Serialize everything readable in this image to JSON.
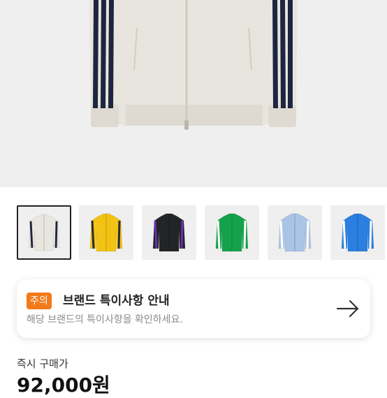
{
  "product": {
    "thumbnails": [
      {
        "name": "cream",
        "body": "#e9e6df",
        "stripe": "#1e2540",
        "selected": true
      },
      {
        "name": "yellow",
        "body": "#f2c315",
        "stripe": "#2d2d2d",
        "selected": false
      },
      {
        "name": "black",
        "body": "#222426",
        "stripe": "#6a2fb0",
        "selected": false
      },
      {
        "name": "green",
        "body": "#13a24b",
        "stripe": "#ffffff",
        "selected": false
      },
      {
        "name": "light-blue",
        "body": "#a9c4e6",
        "stripe": "#ffffff",
        "selected": false
      },
      {
        "name": "blue",
        "body": "#2a7fe0",
        "stripe": "#ffffff",
        "selected": false
      }
    ]
  },
  "notice": {
    "badge": "주의",
    "title": "브랜드 특이사항 안내",
    "description": "해당 브랜드의 특이사항을 확인하세요.",
    "badge_color": "#f27a1a"
  },
  "purchase": {
    "label": "즉시 구매가",
    "price": "92,000원"
  }
}
